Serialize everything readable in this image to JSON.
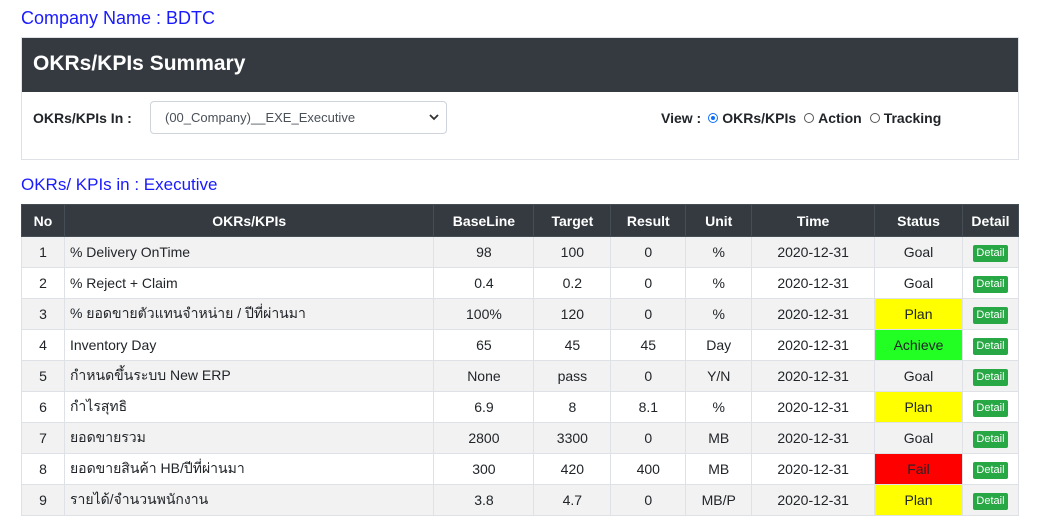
{
  "company": "Company Name : BDTC",
  "panel": {
    "title": "OKRs/KPIs Summary",
    "filter_label": "OKRs/KPIs In :",
    "select_value": "(00_Company)__EXE_Executive",
    "view_label": "View :",
    "view_options": [
      "OKRs/KPIs",
      "Action",
      "Tracking"
    ],
    "view_selected": "OKRs/KPIs"
  },
  "subtitle": "OKRs/ KPIs in : Executive",
  "table": {
    "headers": [
      "No",
      "OKRs/KPIs",
      "BaseLine",
      "Target",
      "Result",
      "Unit",
      "Time",
      "Status",
      "Detail"
    ],
    "rows": [
      {
        "no": "1",
        "kpi": "% Delivery OnTime",
        "baseline": "98",
        "target": "100",
        "result": "0",
        "unit": "%",
        "time": "2020-12-31",
        "status": "Goal",
        "detail": "Detail"
      },
      {
        "no": "2",
        "kpi": "% Reject + Claim",
        "baseline": "0.4",
        "target": "0.2",
        "result": "0",
        "unit": "%",
        "time": "2020-12-31",
        "status": "Goal",
        "detail": "Detail"
      },
      {
        "no": "3",
        "kpi": "% ยอดขายตัวแทนจำหน่าย / ปีที่ผ่านมา",
        "baseline": "100%",
        "target": "120",
        "result": "0",
        "unit": "%",
        "time": "2020-12-31",
        "status": "Plan",
        "detail": "Detail"
      },
      {
        "no": "4",
        "kpi": "Inventory Day",
        "baseline": "65",
        "target": "45",
        "result": "45",
        "unit": "Day",
        "time": "2020-12-31",
        "status": "Achieve",
        "detail": "Detail"
      },
      {
        "no": "5",
        "kpi": "กำหนดขึ้นระบบ New ERP",
        "baseline": "None",
        "target": "pass",
        "result": "0",
        "unit": "Y/N",
        "time": "2020-12-31",
        "status": "Goal",
        "detail": "Detail"
      },
      {
        "no": "6",
        "kpi": "กำไรสุทธิ",
        "baseline": "6.9",
        "target": "8",
        "result": "8.1",
        "unit": "%",
        "time": "2020-12-31",
        "status": "Plan",
        "detail": "Detail"
      },
      {
        "no": "7",
        "kpi": "ยอดขายรวม",
        "baseline": "2800",
        "target": "3300",
        "result": "0",
        "unit": "MB",
        "time": "2020-12-31",
        "status": "Goal",
        "detail": "Detail"
      },
      {
        "no": "8",
        "kpi": "ยอดขายสินค้า HB/ปีที่ผ่านมา",
        "baseline": "300",
        "target": "420",
        "result": "400",
        "unit": "MB",
        "time": "2020-12-31",
        "status": "Fail",
        "detail": "Detail"
      },
      {
        "no": "9",
        "kpi": "รายได้/จำนวนพนักงาน",
        "baseline": "3.8",
        "target": "4.7",
        "result": "0",
        "unit": "MB/P",
        "time": "2020-12-31",
        "status": "Plan",
        "detail": "Detail"
      }
    ]
  },
  "status_colors": {
    "Plan": "#ffff00",
    "Achieve": "#22ff22",
    "Fail": "#ff0000",
    "Goal": "#ffffff"
  }
}
